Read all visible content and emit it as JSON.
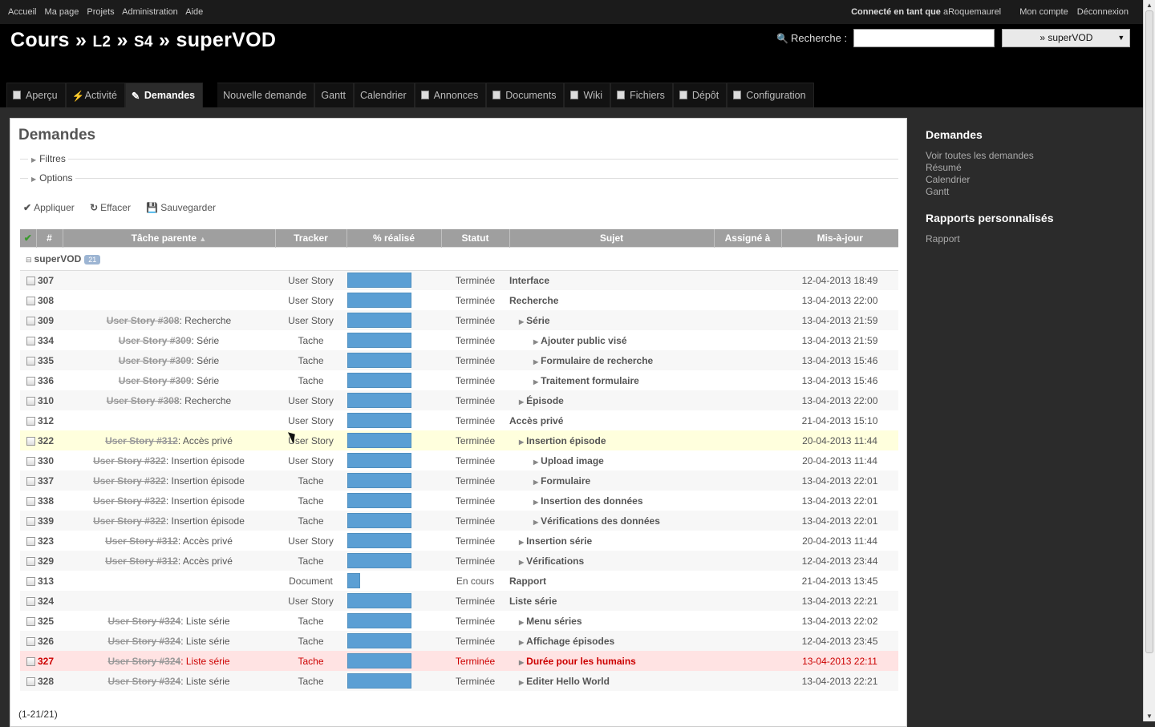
{
  "top_menu": {
    "items": [
      "Accueil",
      "Ma page",
      "Projets",
      "Administration",
      "Aide"
    ],
    "logged_prefix": "Connecté en tant que",
    "user": "aRoquemaurel",
    "account": "Mon compte",
    "logout": "Déconnexion"
  },
  "header": {
    "crumb1": "Cours",
    "sep": "»",
    "crumb2": "L2",
    "crumb3": "S4",
    "project": "superVOD",
    "search_label": "Recherche :",
    "project_select": "» superVOD"
  },
  "tabs": [
    "Aperçu",
    "Activité",
    "Demandes",
    "Nouvelle demande",
    "Gantt",
    "Calendrier",
    "Annonces",
    "Documents",
    "Wiki",
    "Fichiers",
    "Dépôt",
    "Configuration"
  ],
  "content": {
    "title": "Demandes",
    "filters": "Filtres",
    "options": "Options",
    "apply": "Appliquer",
    "clear": "Effacer",
    "save": "Sauvegarder",
    "pagination": "(1-21/21)"
  },
  "table": {
    "columns": [
      "#",
      "Tâche parente",
      "Tracker",
      "% réalisé",
      "Statut",
      "Sujet",
      "Assigné à",
      "Mis-à-jour"
    ],
    "group_name": "superVOD",
    "group_count": "21",
    "rows": [
      {
        "id": "307",
        "parent_link": "",
        "parent_text": "",
        "tracker": "User Story",
        "done": 1.0,
        "status": "Terminée",
        "subject": "Interface",
        "level": 0,
        "updated": "12-04-2013 18:49"
      },
      {
        "id": "308",
        "parent_link": "",
        "parent_text": "",
        "tracker": "User Story",
        "done": 1.0,
        "status": "Terminée",
        "subject": "Recherche",
        "level": 0,
        "updated": "13-04-2013 22:00"
      },
      {
        "id": "309",
        "parent_link": "User Story #308",
        "parent_text": ": Recherche",
        "tracker": "User Story",
        "done": 1.0,
        "status": "Terminée",
        "subject": "Série",
        "level": 1,
        "updated": "13-04-2013 21:59"
      },
      {
        "id": "334",
        "parent_link": "User Story #309",
        "parent_text": ": Série",
        "tracker": "Tache",
        "done": 1.0,
        "status": "Terminée",
        "subject": "Ajouter public visé",
        "level": 2,
        "updated": "13-04-2013 21:59"
      },
      {
        "id": "335",
        "parent_link": "User Story #309",
        "parent_text": ": Série",
        "tracker": "Tache",
        "done": 1.0,
        "status": "Terminée",
        "subject": "Formulaire de recherche",
        "level": 2,
        "updated": "13-04-2013 15:46"
      },
      {
        "id": "336",
        "parent_link": "User Story #309",
        "parent_text": ": Série",
        "tracker": "Tache",
        "done": 1.0,
        "status": "Terminée",
        "subject": "Traitement formulaire",
        "level": 2,
        "updated": "13-04-2013 15:46"
      },
      {
        "id": "310",
        "parent_link": "User Story #308",
        "parent_text": ": Recherche",
        "tracker": "User Story",
        "done": 1.0,
        "status": "Terminée",
        "subject": "Épisode",
        "level": 1,
        "updated": "13-04-2013 22:00"
      },
      {
        "id": "312",
        "parent_link": "",
        "parent_text": "",
        "tracker": "User Story",
        "done": 1.0,
        "status": "Terminée",
        "subject": "Accès privé",
        "level": 0,
        "updated": "21-04-2013 15:10"
      },
      {
        "id": "322",
        "parent_link": "User Story #312",
        "parent_text": ": Accès privé",
        "tracker": "User Story",
        "done": 1.0,
        "status": "Terminée",
        "subject": "Insertion épisode",
        "level": 1,
        "updated": "20-04-2013 11:44",
        "hover": true
      },
      {
        "id": "330",
        "parent_link": "User Story #322",
        "parent_text": ": Insertion épisode",
        "tracker": "User Story",
        "done": 1.0,
        "status": "Terminée",
        "subject": "Upload image",
        "level": 2,
        "updated": "20-04-2013 11:44"
      },
      {
        "id": "337",
        "parent_link": "User Story #322",
        "parent_text": ": Insertion épisode",
        "tracker": "Tache",
        "done": 1.0,
        "status": "Terminée",
        "subject": "Formulaire",
        "level": 2,
        "updated": "13-04-2013 22:01"
      },
      {
        "id": "338",
        "parent_link": "User Story #322",
        "parent_text": ": Insertion épisode",
        "tracker": "Tache",
        "done": 1.0,
        "status": "Terminée",
        "subject": "Insertion des données",
        "level": 2,
        "updated": "13-04-2013 22:01"
      },
      {
        "id": "339",
        "parent_link": "User Story #322",
        "parent_text": ": Insertion épisode",
        "tracker": "Tache",
        "done": 1.0,
        "status": "Terminée",
        "subject": "Vérifications des données",
        "level": 2,
        "updated": "13-04-2013 22:01"
      },
      {
        "id": "323",
        "parent_link": "User Story #312",
        "parent_text": ": Accès privé",
        "tracker": "User Story",
        "done": 1.0,
        "status": "Terminée",
        "subject": "Insertion série",
        "level": 1,
        "updated": "20-04-2013 11:44"
      },
      {
        "id": "329",
        "parent_link": "User Story #312",
        "parent_text": ": Accès privé",
        "tracker": "Tache",
        "done": 1.0,
        "status": "Terminée",
        "subject": "Vérifications",
        "level": 1,
        "updated": "12-04-2013 23:44"
      },
      {
        "id": "313",
        "parent_link": "",
        "parent_text": "",
        "tracker": "Document",
        "done": 0.2,
        "status": "En cours",
        "subject": "Rapport",
        "level": 0,
        "updated": "21-04-2013 13:45"
      },
      {
        "id": "324",
        "parent_link": "",
        "parent_text": "",
        "tracker": "User Story",
        "done": 1.0,
        "status": "Terminée",
        "subject": "Liste série",
        "level": 0,
        "updated": "13-04-2013 22:21"
      },
      {
        "id": "325",
        "parent_link": "User Story #324",
        "parent_text": ": Liste série",
        "tracker": "Tache",
        "done": 1.0,
        "status": "Terminée",
        "subject": "Menu séries",
        "level": 1,
        "updated": "13-04-2013 22:02"
      },
      {
        "id": "326",
        "parent_link": "User Story #324",
        "parent_text": ": Liste série",
        "tracker": "Tache",
        "done": 1.0,
        "status": "Terminée",
        "subject": "Affichage épisodes",
        "level": 1,
        "updated": "12-04-2013 23:45"
      },
      {
        "id": "327",
        "parent_link": "User Story #324",
        "parent_text": ": Liste série",
        "tracker": "Tache",
        "done": 1.0,
        "status": "Terminée",
        "subject": "Durée pour les humains",
        "level": 1,
        "updated": "13-04-2013 22:11",
        "overdue": true
      },
      {
        "id": "328",
        "parent_link": "User Story #324",
        "parent_text": ": Liste série",
        "tracker": "Tache",
        "done": 1.0,
        "status": "Terminée",
        "subject": "Editer Hello World",
        "level": 1,
        "updated": "13-04-2013 22:21"
      }
    ]
  },
  "sidebar": {
    "title1": "Demandes",
    "links1": [
      "Voir toutes les demandes",
      "Résumé",
      "Calendrier",
      "Gantt"
    ],
    "title2": "Rapports personnalisés",
    "links2": [
      "Rapport"
    ]
  },
  "colors": {
    "progress": "#5b9fd4",
    "header_bg": "#000000",
    "overdue_text": "#cc0000"
  }
}
